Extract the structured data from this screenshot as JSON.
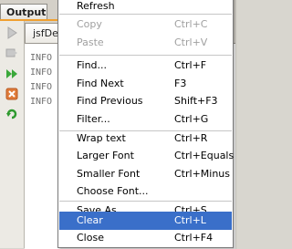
{
  "output_window": {
    "title": "Output",
    "tab_label": "jsfDen",
    "log_lines": [
      "INFO",
      "INFO",
      "INFO",
      "INFO"
    ]
  },
  "toolbar": {
    "buttons": [
      {
        "icon": "play-icon"
      },
      {
        "icon": "stop-icon"
      },
      {
        "icon": "fast-forward-icon"
      },
      {
        "icon": "close-icon"
      },
      {
        "icon": "refresh-icon"
      }
    ]
  },
  "context_menu": {
    "refresh": {
      "label": "Refresh"
    },
    "copy": {
      "label": "Copy",
      "shortcut": "Ctrl+C"
    },
    "paste": {
      "label": "Paste",
      "shortcut": "Ctrl+V"
    },
    "find": {
      "label": "Find...",
      "shortcut": "Ctrl+F"
    },
    "find_next": {
      "label": "Find Next",
      "shortcut": "F3"
    },
    "find_previous": {
      "label": "Find Previous",
      "shortcut": "Shift+F3"
    },
    "filter": {
      "label": "Filter...",
      "shortcut": "Ctrl+G"
    },
    "wrap_text": {
      "label": "Wrap text",
      "shortcut": "Ctrl+R"
    },
    "larger_font": {
      "label": "Larger Font",
      "shortcut": "Ctrl+Equals"
    },
    "smaller_font": {
      "label": "Smaller Font",
      "shortcut": "Ctrl+Minus"
    },
    "choose_font": {
      "label": "Choose Font..."
    },
    "save_as": {
      "label": "Save As...",
      "shortcut": "Ctrl+S"
    },
    "clear": {
      "label": "Clear",
      "shortcut": "Ctrl+L"
    },
    "close": {
      "label": "Close",
      "shortcut": "Ctrl+F4"
    }
  },
  "colors": {
    "selection": "#3a6fc9",
    "disabled_text": "#a0a0a0",
    "accent_strip": "#f0a030"
  }
}
